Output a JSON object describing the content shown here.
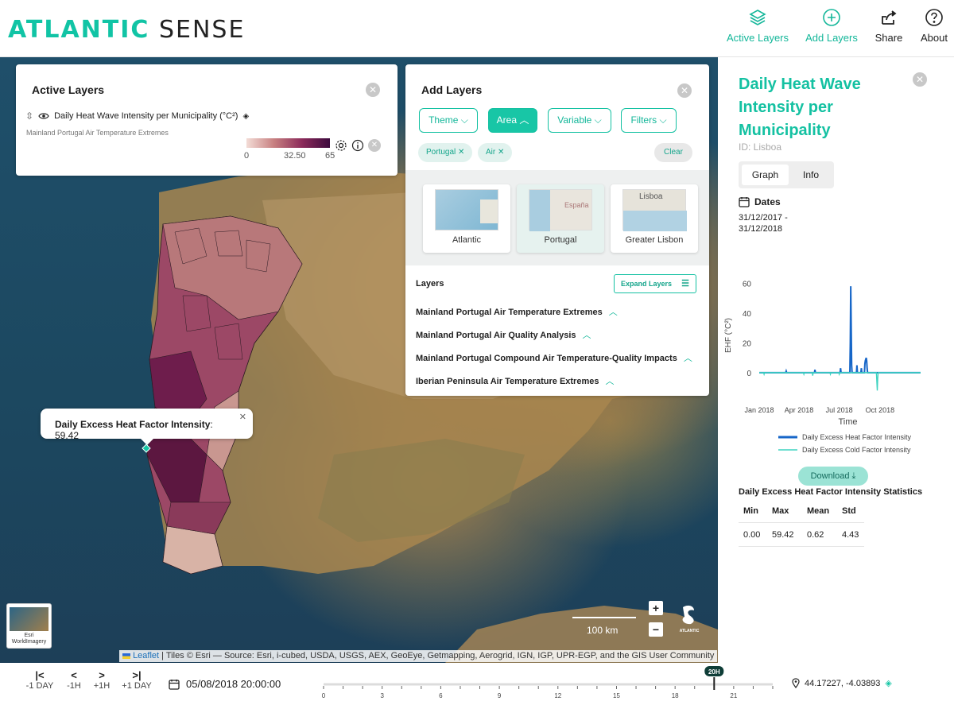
{
  "header": {
    "logo_part1": "ATLANTIC",
    "logo_part2": "SENSE",
    "nav": [
      {
        "label": "Active Layers",
        "icon": "layers-icon"
      },
      {
        "label": "Add Layers",
        "icon": "plus-circle-icon"
      },
      {
        "label": "Share",
        "icon": "share-icon"
      },
      {
        "label": "About",
        "icon": "help-icon"
      }
    ]
  },
  "active_layers": {
    "title": "Active Layers",
    "layer_name": "Daily Heat Wave Intensity per Municipality (°C²)",
    "layer_group": "Mainland Portugal Air Temperature Extremes",
    "legend_min": "0",
    "legend_mid": "32.50",
    "legend_max": "65"
  },
  "add_layers": {
    "title": "Add Layers",
    "filters": [
      "Theme",
      "Area",
      "Variable",
      "Filters"
    ],
    "tags": [
      "Portugal",
      "Air"
    ],
    "clear_label": "Clear",
    "areas": [
      "Atlantic",
      "Portugal",
      "Greater Lisbon"
    ],
    "area_thumb_labels": [
      "España",
      "Lisboa"
    ],
    "layers_heading": "Layers",
    "expand_label": "Expand Layers",
    "layers": [
      "Mainland Portugal Air Temperature Extremes",
      "Mainland Portugal Air Quality Analysis",
      "Mainland Portugal Compound Air Temperature-Quality Impacts",
      "Iberian Peninsula Air Temperature Extremes"
    ]
  },
  "map": {
    "popup_label": "Daily Excess Heat Factor Intensity",
    "popup_value": ": 59.42",
    "scale_label": "100 km",
    "basemap_label": "Esri WorldImagery",
    "attribution_leaflet": "Leaflet",
    "attribution_rest": " | Tiles © Esri — Source: Esri, i-cubed, USDA, USGS, AEX, GeoEye, Getmapping, Aerogrid, IGN, IGP, UPR-EGP, and the GIS User Community",
    "watermark": "ATLANTIC"
  },
  "side_panel": {
    "title": "Daily Heat Wave Intensity per Municipality",
    "id_label": "ID: Lisboa",
    "tabs": [
      "Graph",
      "Info"
    ],
    "dates_heading": "Dates",
    "dates_range_1": "31/12/2017 -",
    "dates_range_2": "31/12/2018",
    "download_label": "Download",
    "stats_title": "Daily Excess Heat Factor Intensity Statistics",
    "stats_headers": [
      "Min",
      "Max",
      "Mean",
      "Std"
    ],
    "stats_values": [
      "0.00",
      "59.42",
      "0.62",
      "4.43"
    ]
  },
  "chart_data": {
    "type": "line",
    "xlabel": "Time",
    "ylabel": "EHF (°C²)",
    "x_ticks": [
      "Jan 2018",
      "Apr 2018",
      "Jul 2018",
      "Oct 2018"
    ],
    "y_ticks": [
      "0",
      "20",
      "40",
      "60"
    ],
    "ylim": [
      -15,
      65
    ],
    "series": [
      {
        "name": "Daily Excess Heat Factor Intensity",
        "color": "#1666c8",
        "x": [
          0,
          60,
          61,
          62,
          125,
          126,
          127,
          183,
          184,
          185,
          205,
          206,
          207,
          208,
          209,
          210,
          220,
          221,
          222,
          230,
          231,
          232,
          238,
          239,
          240,
          242,
          243,
          244,
          245,
          250,
          365
        ],
        "y": [
          0,
          0,
          1,
          0,
          0,
          2,
          0,
          0,
          3,
          0,
          0,
          20,
          58,
          30,
          5,
          0,
          0,
          5,
          0,
          0,
          3,
          0,
          0,
          6,
          8,
          10,
          8,
          3,
          0,
          0,
          0
        ]
      },
      {
        "name": "Daily Excess Cold Factor Intensity",
        "color": "#3ed3c0",
        "x": [
          0,
          10,
          11,
          12,
          100,
          101,
          102,
          120,
          121,
          122,
          160,
          161,
          162,
          180,
          181,
          182,
          240,
          265,
          266,
          267,
          268,
          269,
          270,
          365
        ],
        "y": [
          0,
          0,
          -1,
          0,
          0,
          -1,
          0,
          0,
          -2,
          0,
          0,
          -1,
          0,
          0,
          -1,
          0,
          0,
          0,
          -6,
          -12,
          -4,
          0,
          0,
          0
        ]
      }
    ]
  },
  "timeline": {
    "buttons": [
      "-1 DAY",
      "-1H",
      "+1H",
      "+1 DAY"
    ],
    "datetime": "05/08/2018 20:00:00",
    "hour_badge": "20H",
    "ticks": [
      "0",
      "3",
      "6",
      "9",
      "12",
      "15",
      "18",
      "21"
    ],
    "current_hour": 20,
    "coordinates": "44.17227, -4.03893"
  }
}
